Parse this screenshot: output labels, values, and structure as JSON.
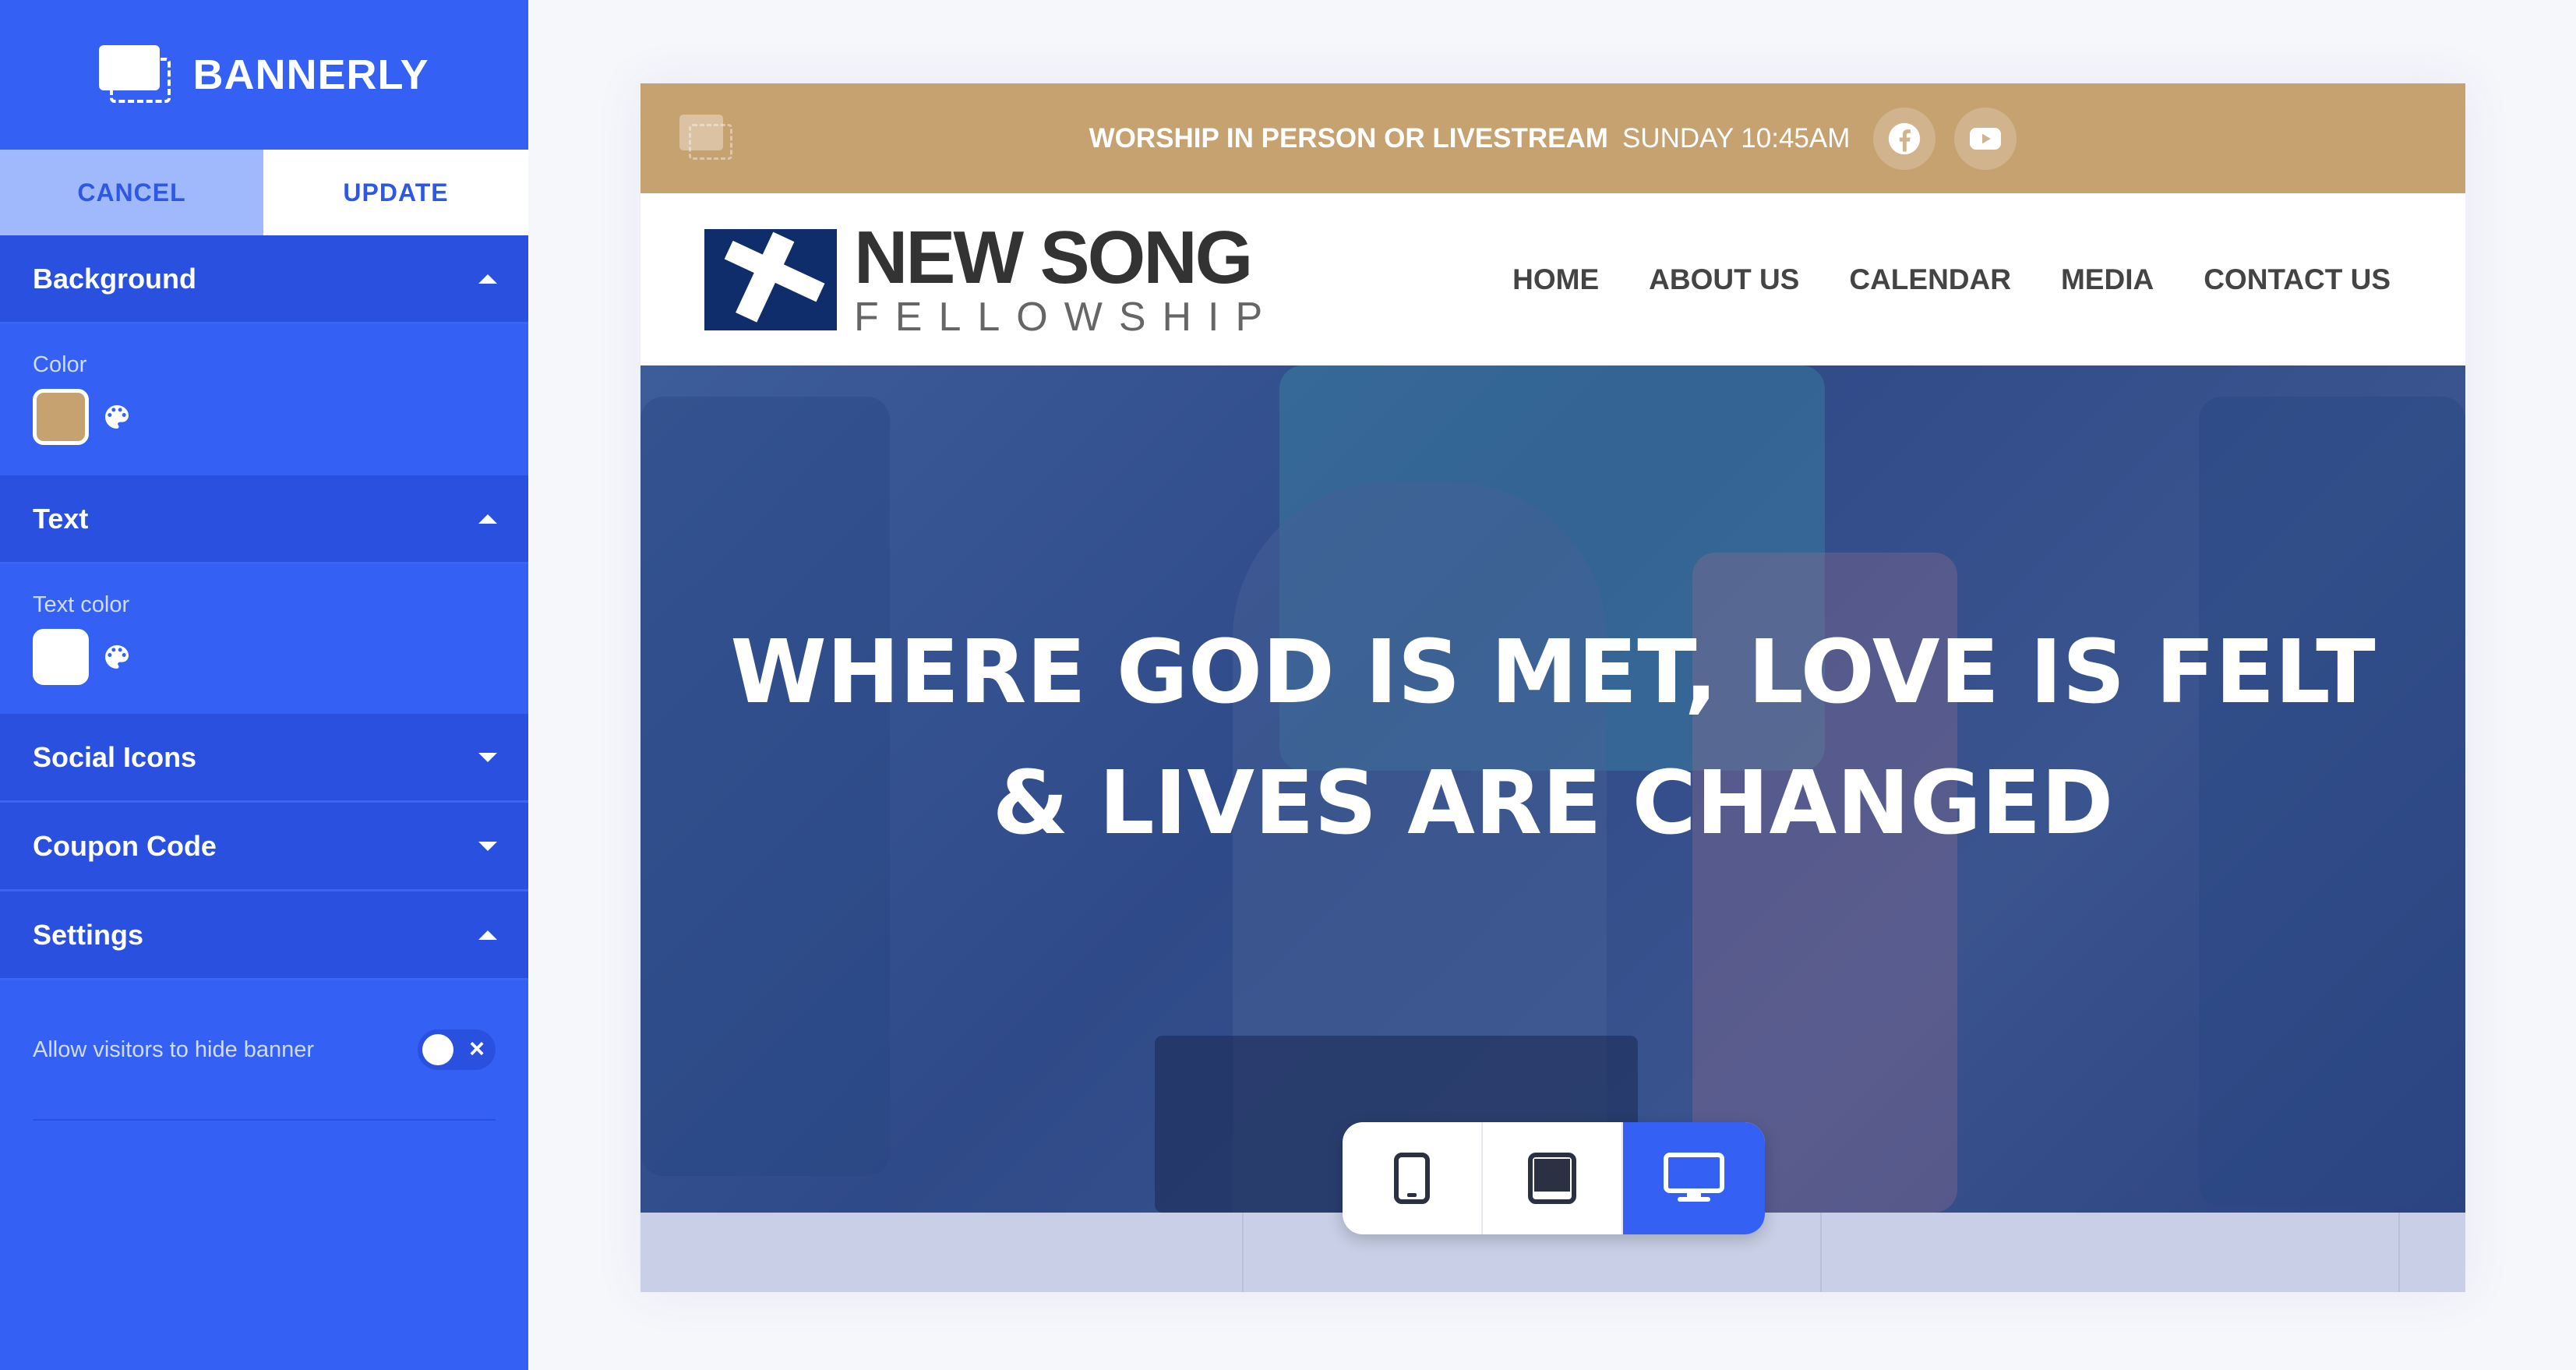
{
  "sidebar": {
    "brand": "BANNERLY",
    "cancel_label": "CANCEL",
    "update_label": "UPDATE",
    "sections": {
      "background": {
        "title": "Background",
        "color_label": "Color",
        "color": "#c6a271"
      },
      "text": {
        "title": "Text",
        "color_label": "Text color",
        "color": "#ffffff"
      },
      "social_icons": {
        "title": "Social Icons"
      },
      "coupon_code": {
        "title": "Coupon Code"
      },
      "settings": {
        "title": "Settings",
        "hide_banner_label": "Allow visitors to hide banner",
        "hide_banner_enabled": false
      }
    }
  },
  "banner": {
    "text": "WORSHIP IN PERSON OR LIVESTREAM",
    "time": "SUNDAY 10:45AM",
    "icons": [
      "facebook-icon",
      "youtube-icon"
    ]
  },
  "site": {
    "logo_line1": "NEW SONG",
    "logo_line2": "FELLOWSHIP",
    "nav": [
      "HOME",
      "ABOUT US",
      "CALENDAR",
      "MEDIA",
      "CONTACT US"
    ],
    "hero_line1": "WHERE GOD IS MET, LOVE IS FELT",
    "hero_line2": "& LIVES ARE CHANGED"
  },
  "device_switch": {
    "devices": [
      "mobile-icon",
      "tablet-icon",
      "desktop-icon"
    ],
    "active": "desktop"
  },
  "colors": {
    "accent": "#3461f4",
    "banner_bg": "#c6a271"
  }
}
